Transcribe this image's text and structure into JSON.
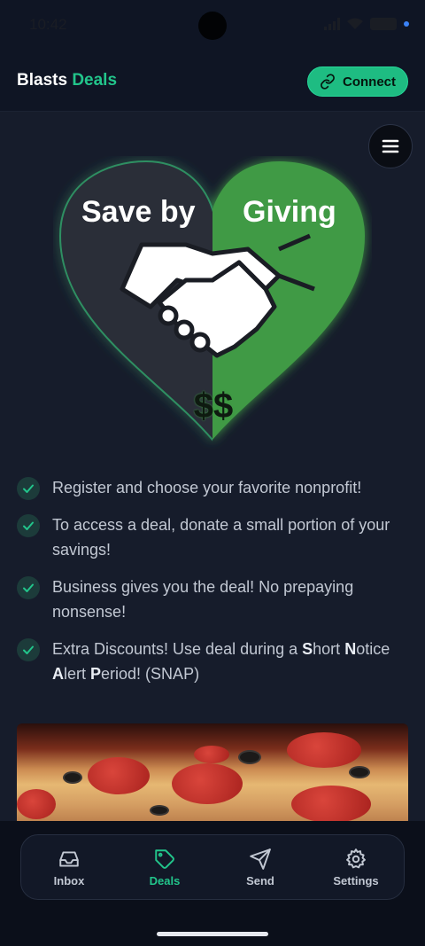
{
  "status_bar": {
    "time": "10:42"
  },
  "header": {
    "brand_primary": "Blasts",
    "brand_accent": "Deals",
    "connect_label": "Connect"
  },
  "hero": {
    "text_left": "Save by",
    "text_right": "Giving",
    "currency": "$$"
  },
  "features": [
    {
      "text": "Register and choose your favorite nonprofit!"
    },
    {
      "text": "To access a deal, donate a small portion of your savings!"
    },
    {
      "text": "Business gives you the deal! No prepaying nonsense!"
    },
    {
      "text_html_parts": [
        "Extra Discounts! Use deal during a ",
        "S",
        "hort ",
        "N",
        "otice ",
        "A",
        "lert ",
        "P",
        "eriod! (SNAP)"
      ]
    }
  ],
  "nav": [
    {
      "label": "Inbox",
      "icon": "inbox-icon"
    },
    {
      "label": "Deals",
      "icon": "tag-icon",
      "active": true
    },
    {
      "label": "Send",
      "icon": "send-icon"
    },
    {
      "label": "Settings",
      "icon": "gear-icon"
    }
  ],
  "colors": {
    "accent": "#22c58b",
    "background": "#161c2b",
    "header_bg": "#0f1524",
    "heart_green": "#3f9a45",
    "heart_dark": "#2a2f38"
  }
}
